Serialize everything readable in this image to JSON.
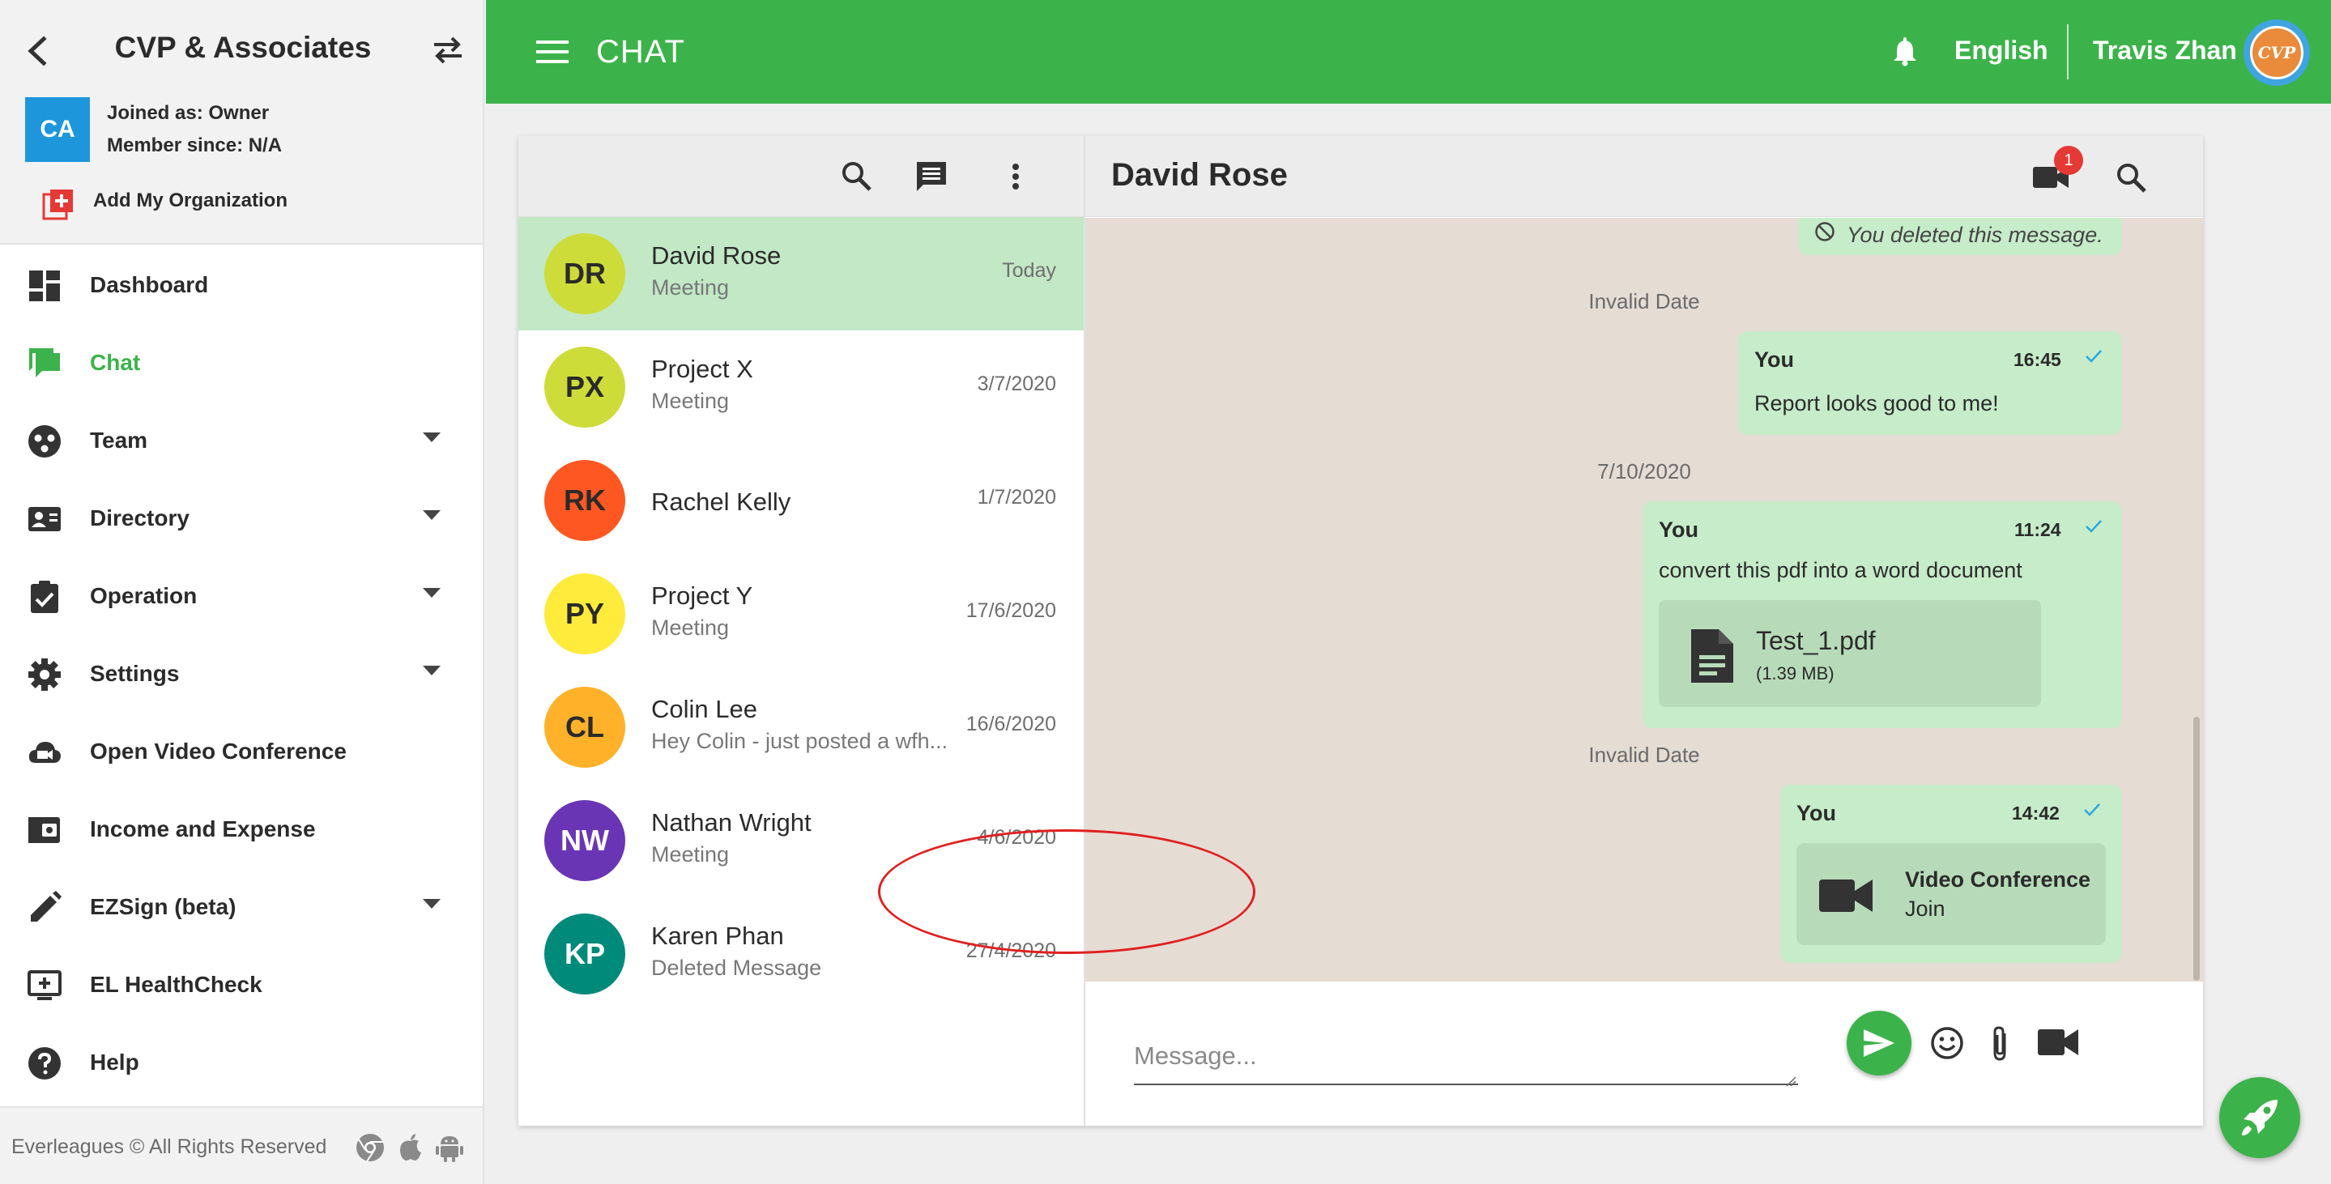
{
  "sidebar": {
    "org_name": "CVP & Associates",
    "org_initials": "CA",
    "joined_as": "Joined as: Owner",
    "member_since": "Member since: N/A",
    "add_org": "Add My Organization",
    "items": [
      {
        "label": "Dashboard",
        "icon": "dashboard-icon",
        "expandable": false,
        "active": false
      },
      {
        "label": "Chat",
        "icon": "chat-icon",
        "expandable": false,
        "active": true
      },
      {
        "label": "Team",
        "icon": "team-icon",
        "expandable": true,
        "active": false
      },
      {
        "label": "Directory",
        "icon": "contact-card-icon",
        "expandable": true,
        "active": false
      },
      {
        "label": "Operation",
        "icon": "clipboard-check-icon",
        "expandable": true,
        "active": false
      },
      {
        "label": "Settings",
        "icon": "gear-icon",
        "expandable": true,
        "active": false
      },
      {
        "label": "Open Video Conference",
        "icon": "cloud-video-icon",
        "expandable": false,
        "active": false
      },
      {
        "label": "Income and Expense",
        "icon": "wallet-icon",
        "expandable": false,
        "active": false
      },
      {
        "label": "EZSign (beta)",
        "icon": "pencil-icon",
        "expandable": true,
        "active": false
      },
      {
        "label": "EL HealthCheck",
        "icon": "monitor-plus-icon",
        "expandable": false,
        "active": false
      },
      {
        "label": "Help",
        "icon": "help-icon",
        "expandable": false,
        "active": false
      }
    ],
    "copyright": "Everleagues © All Rights Reserved",
    "platform_icons": [
      "chrome-icon",
      "apple-icon",
      "android-icon"
    ]
  },
  "topbar": {
    "title": "CHAT",
    "language": "English",
    "user_name": "Travis Zhan",
    "user_avatar_text": "CVP"
  },
  "chat_list": [
    {
      "initials": "DR",
      "name": "David Rose",
      "subtitle": "Meeting",
      "date": "Today",
      "color": "#cddc39",
      "text_color": "#2b2b2b",
      "selected": true
    },
    {
      "initials": "PX",
      "name": "Project X",
      "subtitle": "Meeting",
      "date": "3/7/2020",
      "color": "#cddc39",
      "text_color": "#2b2b2b",
      "selected": false
    },
    {
      "initials": "RK",
      "name": "Rachel Kelly",
      "subtitle": "",
      "date": "1/7/2020",
      "color": "#ff5722",
      "text_color": "#2b2b2b",
      "selected": false
    },
    {
      "initials": "PY",
      "name": "Project Y",
      "subtitle": "Meeting",
      "date": "17/6/2020",
      "color": "#ffeb3b",
      "text_color": "#2b2b2b",
      "selected": false
    },
    {
      "initials": "CL",
      "name": "Colin Lee",
      "subtitle": "Hey Colin - just posted a wfh...",
      "date": "16/6/2020",
      "color": "#ffb12a",
      "text_color": "#2b2b2b",
      "selected": false
    },
    {
      "initials": "NW",
      "name": "Nathan Wright",
      "subtitle": "Meeting",
      "date": "4/6/2020",
      "color": "#6a35b5",
      "text_color": "#ffffff",
      "selected": false
    },
    {
      "initials": "KP",
      "name": "Karen Phan",
      "subtitle": "Deleted Message",
      "date": "27/4/2020",
      "color": "#008a7a",
      "text_color": "#ffffff",
      "selected": false
    }
  ],
  "conversation": {
    "title": "David Rose",
    "video_badge": "1",
    "deleted_message": "You deleted this message.",
    "date_separators": [
      "Invalid Date",
      "7/10/2020",
      "Invalid Date"
    ],
    "messages": [
      {
        "sender": "You",
        "time": "16:45",
        "text": "Report looks good to me!"
      },
      {
        "sender": "You",
        "time": "11:24",
        "text": "convert this pdf into a word document",
        "file": {
          "name": "Test_1.pdf",
          "size": "(1.39 MB)"
        }
      },
      {
        "sender": "You",
        "time": "14:42",
        "video_conference": {
          "title": "Video Conference",
          "action": "Join"
        }
      }
    ]
  },
  "composer": {
    "placeholder": "Message..."
  },
  "colors": {
    "accent": "#3cb34a",
    "selected_row": "#c2e8c6",
    "bubble": "#c6ecc9",
    "chat_background": "#e5dcd4",
    "badge": "#e53935",
    "highlight_ring": "#e02020"
  }
}
